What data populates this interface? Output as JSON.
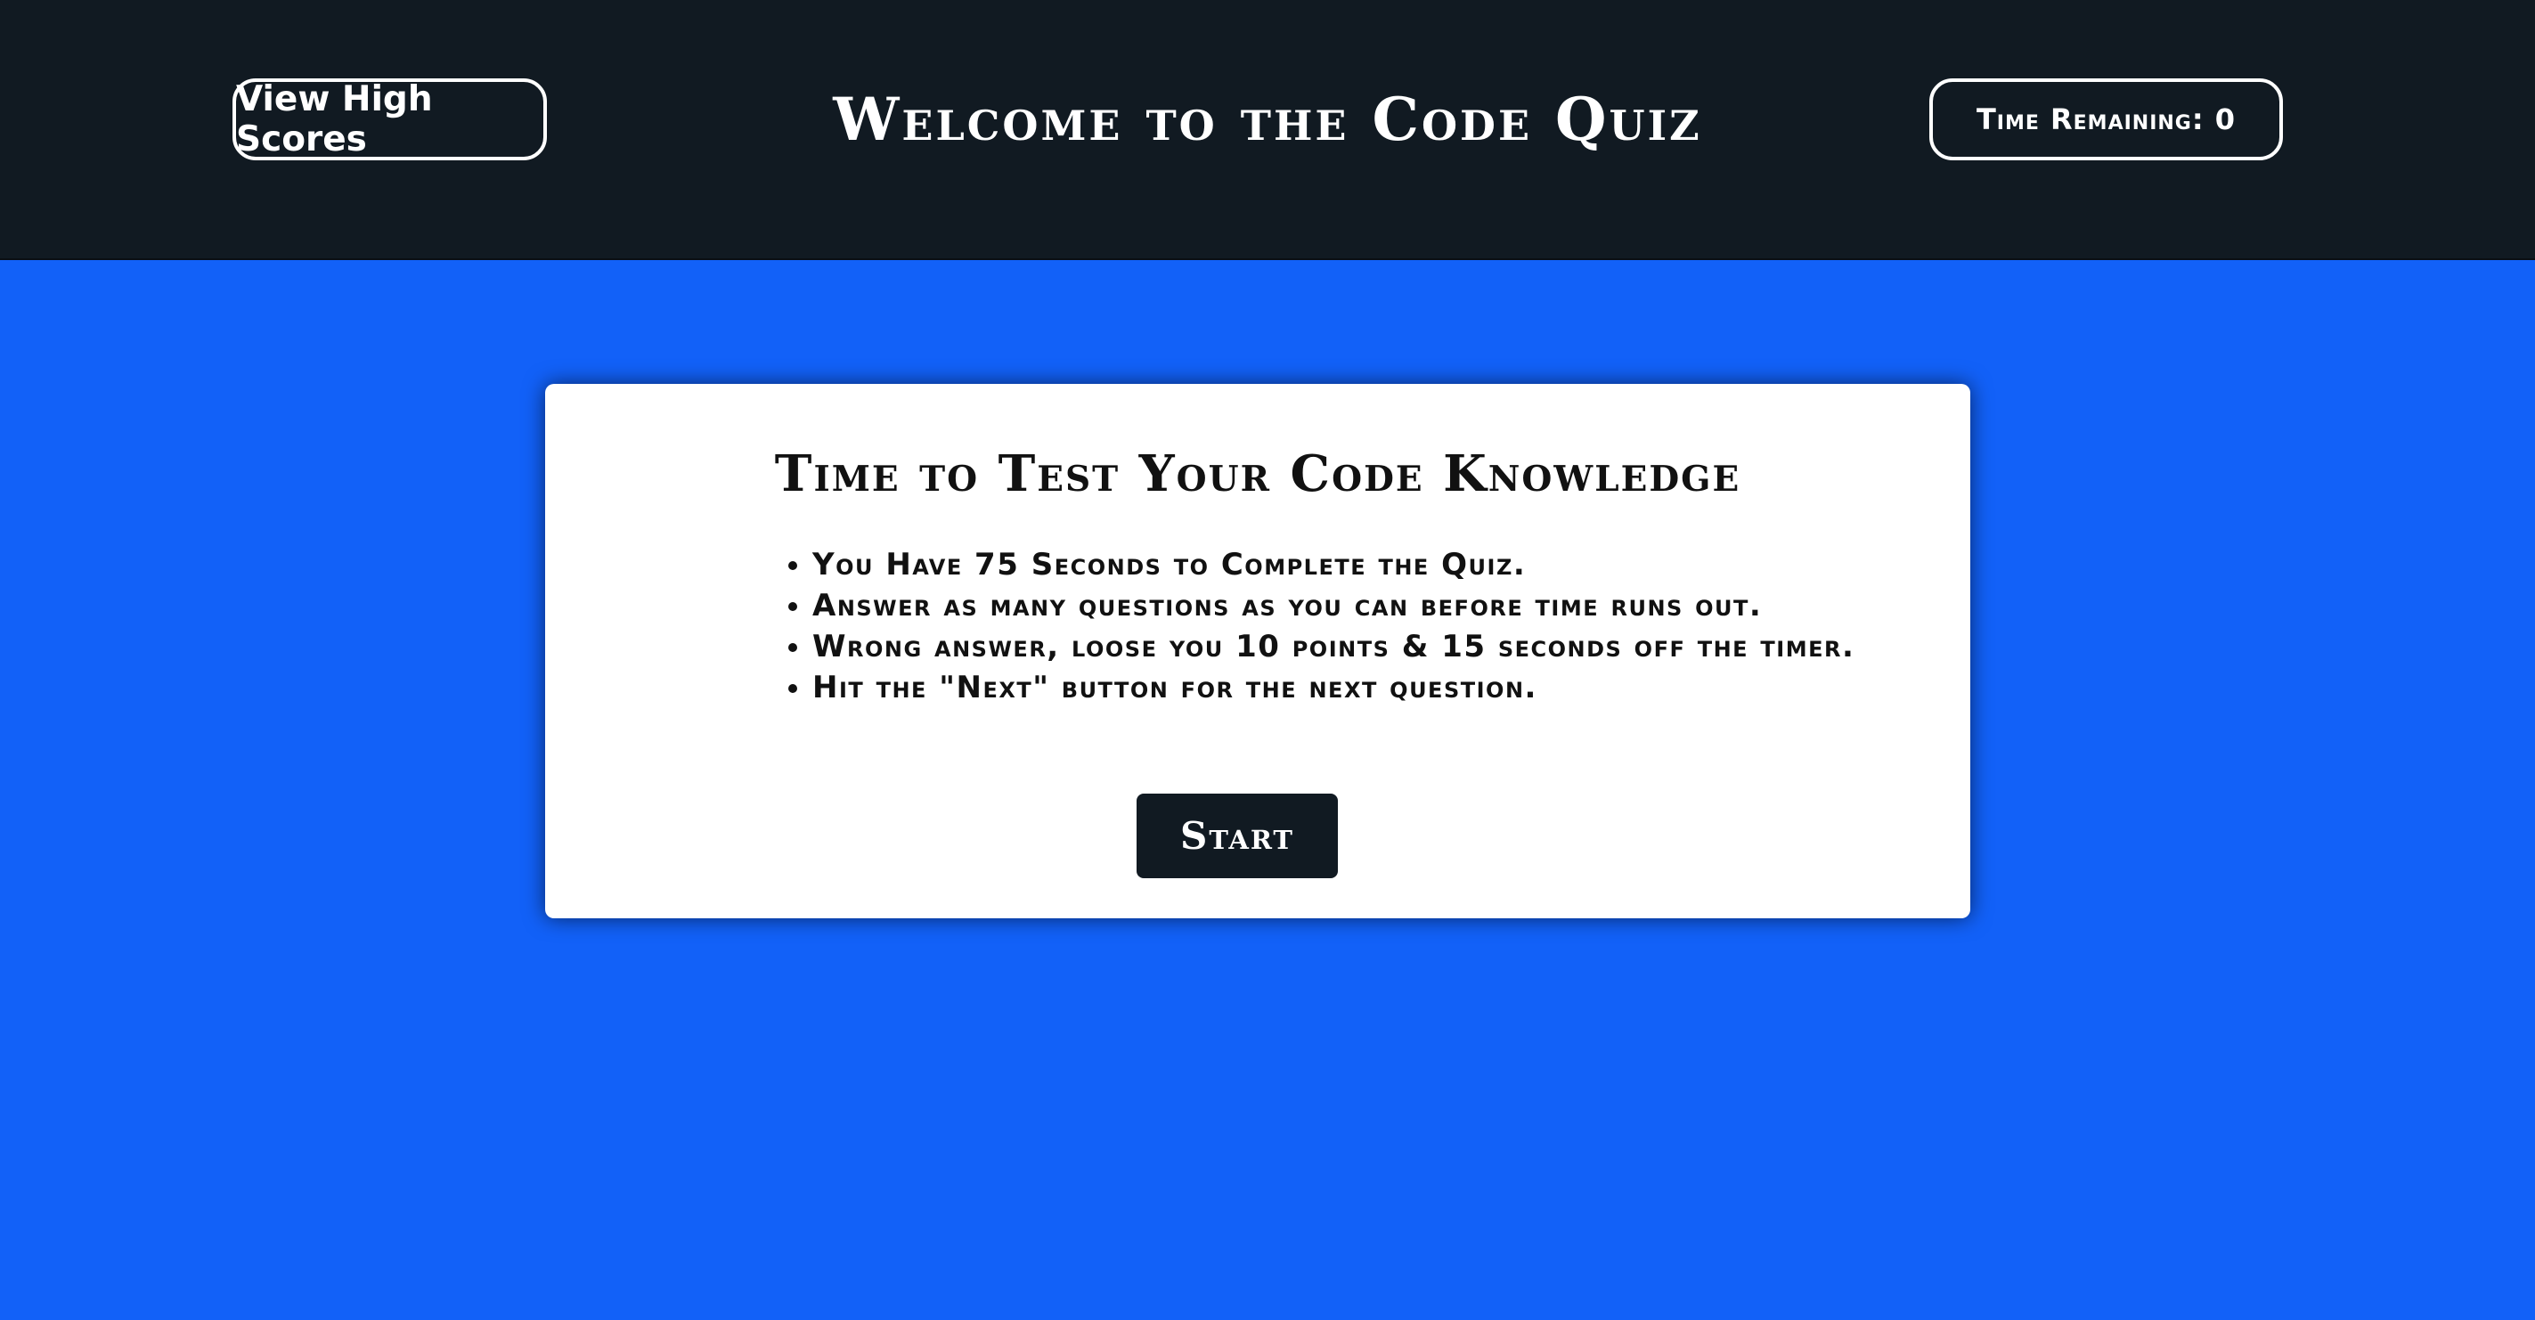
{
  "header": {
    "high_scores_label": "View High Scores",
    "title": "Welcome to the Code Quiz",
    "timer_label": "Time Remaining: 0"
  },
  "card": {
    "title": "Time to Test Your Code Knowledge",
    "rules": [
      "You Have 75 Seconds to Complete the Quiz.",
      "Answer as many questions as you can before time runs out.",
      "Wrong answer, loose you 10 points & 15 seconds off the timer.",
      "Hit the \"Next\" button for the next question."
    ],
    "start_label": "Start"
  },
  "colors": {
    "header_bg": "#111a22",
    "page_bg": "#1261f8",
    "card_bg": "#ffffff"
  }
}
